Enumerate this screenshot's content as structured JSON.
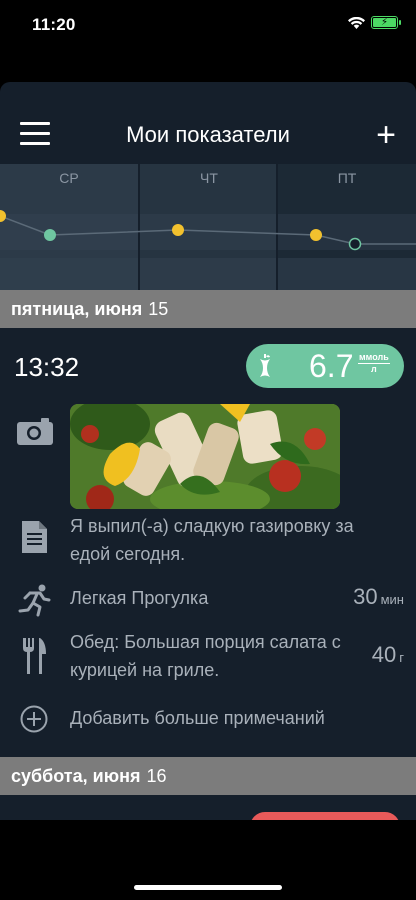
{
  "status": {
    "time": "11:20"
  },
  "nav": {
    "title": "Мои показатели"
  },
  "week": {
    "days": [
      "СР",
      "ЧТ",
      "ПТ"
    ]
  },
  "section1": {
    "weekday": "пятница, июня",
    "day": "15"
  },
  "entry": {
    "time": "13:32",
    "glucose": {
      "value": "6.7",
      "unit_top": "ммоль",
      "unit_bottom": "л"
    },
    "note": "Я выпил(-а) сладкую газировку за едой сегодня.",
    "activity": {
      "label": "Легкая Прогулка",
      "value": "30",
      "unit": "мин"
    },
    "meal": {
      "label": "Обед: Большая порция салата с курицей на гриле.",
      "value": "40",
      "unit": "г"
    },
    "add_more": "Добавить больше примечаний"
  },
  "section2": {
    "weekday": "суббота, июня",
    "day": "16"
  },
  "colors": {
    "background": "#151f2b",
    "accent_green": "#6fc6a1",
    "point_yellow": "#f2c12e",
    "header_gray": "#7c7c7c"
  }
}
